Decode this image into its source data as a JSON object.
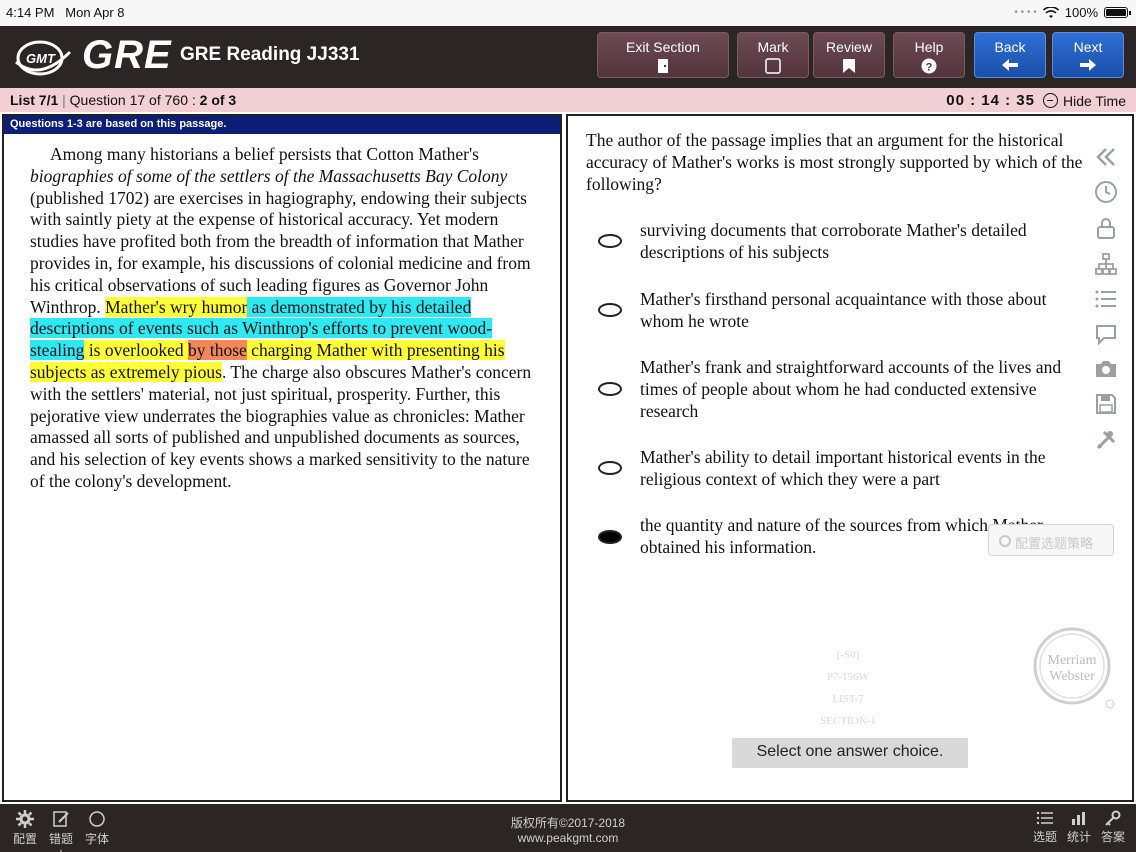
{
  "status": {
    "time": "4:14 PM",
    "date": "Mon Apr 8",
    "battery": "100%"
  },
  "header": {
    "brand": "GRE",
    "logo_text": "GMT",
    "title": "GRE Reading JJ331",
    "buttons": {
      "exit": "Exit Section",
      "mark": "Mark",
      "review": "Review",
      "help": "Help",
      "back": "Back",
      "next": "Next"
    }
  },
  "info": {
    "list": "List 7/1",
    "question": "Question 17 of 760 :",
    "part": "2 of 3",
    "timer": "00 : 14 : 35",
    "hide_time": "Hide Time"
  },
  "passage": {
    "note": "Questions 1-3 are based on this passage.",
    "s1": "Among many historians a belief persists that Cotton Mather's ",
    "s1_italic": "biographies of some of the settlers of the Massachusetts Bay Colony",
    "s2": " (published 1702) are exercises in hagiography, endowing their subjects with saintly piety at the expense of historical accuracy. Yet modern studies have profited both from the breadth of information that Mather provides in, for example, his discussions of colonial medicine and from his critical observations of such leading figures as Governor John Winthrop. ",
    "h1": "Mather's wry humor",
    "h2": " as demonstrated by his detailed descriptions of events such as Winthrop's efforts to prevent wood-stealing",
    "h3": " is overlooked ",
    "h4": "by those",
    "h5": " charging Mather with presenting his subjects as extremely pious",
    "s3": ". The charge also obscures Mather's concern with the settlers' material, not just spiritual, prosperity. Further, this pejorative view underrates the biographies value as chronicles: Mather amassed all sorts of published and unpublished documents as sources, and his selection of key events shows a marked sensitivity to the nature of the colony's development."
  },
  "question": {
    "prompt": "The author of the passage implies that an argument for the historical accuracy of Mather's works is most strongly supported by which of the following?",
    "choices": [
      "surviving documents that corroborate Mather's detailed descriptions of his subjects",
      "Mather's firsthand personal acquaintance with those about whom he wrote",
      "Mather's frank and straightforward accounts of the lives and times of people about whom he had conducted extensive research",
      "Mather's ability to detail important historical events in the religious context of which they were a part",
      "the quantity and nature of the sources from which Mather obtained his information."
    ],
    "selected_index": 4,
    "instruction": "Select one answer choice."
  },
  "overlay": {
    "strategy_button": "配置选题策略",
    "watermark": [
      "[-S0]",
      "P7-156W",
      "LIST-7",
      "SECTION-1"
    ],
    "logo_line1": "Merriam",
    "logo_line2": "Webster"
  },
  "bottom": {
    "left_items": [
      "配置",
      "错题本",
      "字体"
    ],
    "copyright_line1": "版权所有©2017-2018",
    "copyright_line2": "www.peakgmt.com",
    "right_items": [
      "选题",
      "统计",
      "答案"
    ]
  },
  "colors": {
    "header_bg": "#2b2526",
    "info_bg": "#f2cfd5",
    "note_bg": "#0c1e76",
    "highlight_yellow": "#ffff38",
    "highlight_cyan": "#2ee8f2",
    "highlight_orange": "#f2885a",
    "nav_blue": "#2f6fd6"
  }
}
